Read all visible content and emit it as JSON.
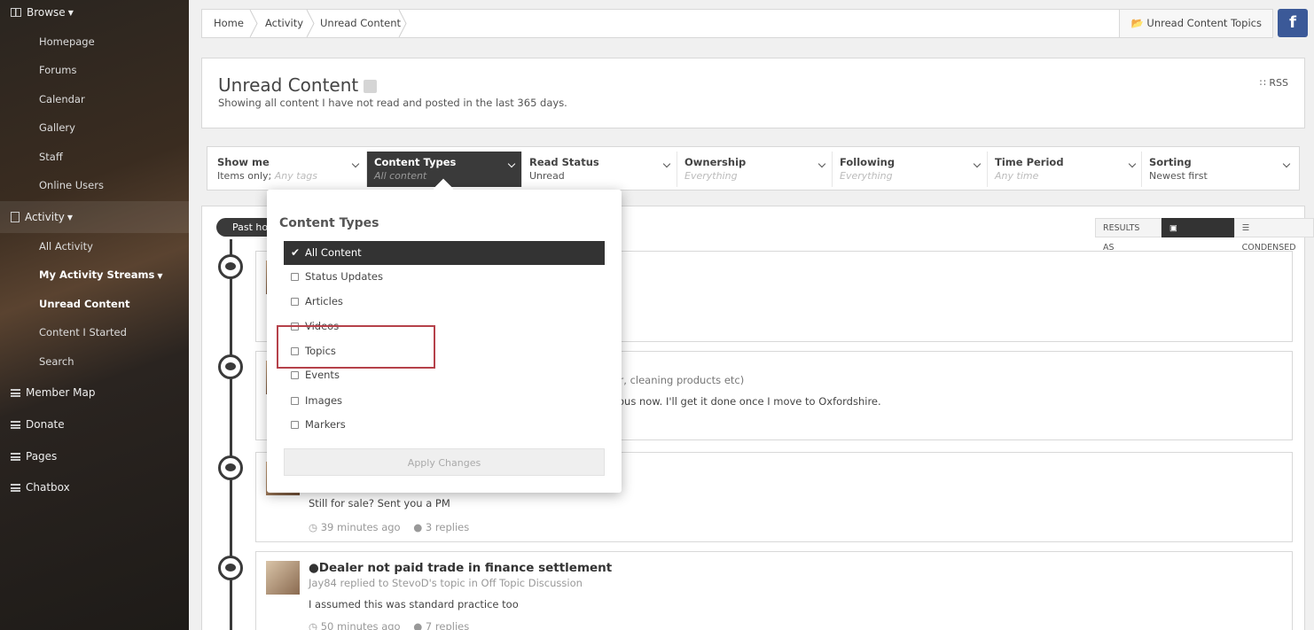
{
  "sidebar": {
    "browse_label": "Browse",
    "browse_items": [
      "Homepage",
      "Forums",
      "Calendar",
      "Gallery",
      "Staff",
      "Online Users"
    ],
    "activity_label": "Activity",
    "activity_items": [
      "All Activity",
      "My Activity Streams",
      "Unread Content",
      "Content I Started",
      "Search"
    ],
    "member_map": "Member Map",
    "donate": "Donate",
    "pages": "Pages",
    "chatbox": "Chatbox"
  },
  "breadcrumb": [
    "Home",
    "Activity",
    "Unread Content"
  ],
  "unread_topics_button": "Unread Content Topics",
  "facebook_label": "f",
  "header": {
    "title": "Unread Content",
    "subtitle": "Showing all content I have not read and posted in the last 365 days.",
    "rss": "RSS"
  },
  "filters": [
    {
      "label": "Show me",
      "value": "Items only; Any tags"
    },
    {
      "label": "Content Types",
      "value": "All content"
    },
    {
      "label": "Read Status",
      "value": "Unread"
    },
    {
      "label": "Ownership",
      "value": "Everything"
    },
    {
      "label": "Following",
      "value": "Everything"
    },
    {
      "label": "Time Period",
      "value": "Any time"
    },
    {
      "label": "Sorting",
      "value": "Newest first"
    }
  ],
  "filter_show_me_prefix": "Items only;",
  "filter_show_me_suffix": "Any tags",
  "past_hour_pill": "Past hou",
  "results_as": {
    "label": "RESULTS AS",
    "expanded": "EXPANDED",
    "condensed": "CONDENSED"
  },
  "dropdown": {
    "title": "Content Types",
    "options": [
      "All Content",
      "Status Updates",
      "Articles",
      "Videos",
      "Topics",
      "Events",
      "Images",
      "Markers"
    ],
    "apply": "Apply Changes"
  },
  "partial_texts": {
    "card2_line1": "pair, cleaning products etc)",
    "card2_line2": "vious now. I'll get it done once I move to Oxfordshire."
  },
  "cards": [
    {
      "body": "Still for sale? Sent you a PM",
      "time": "39 minutes ago",
      "replies": "3 replies"
    },
    {
      "title": "Dealer not paid trade in finance settlement",
      "meta": "Jay84 replied to StevoD's topic in Off Topic Discussion",
      "body": "I assumed this was standard practice too",
      "time": "50 minutes ago",
      "replies": "7 replies"
    }
  ]
}
